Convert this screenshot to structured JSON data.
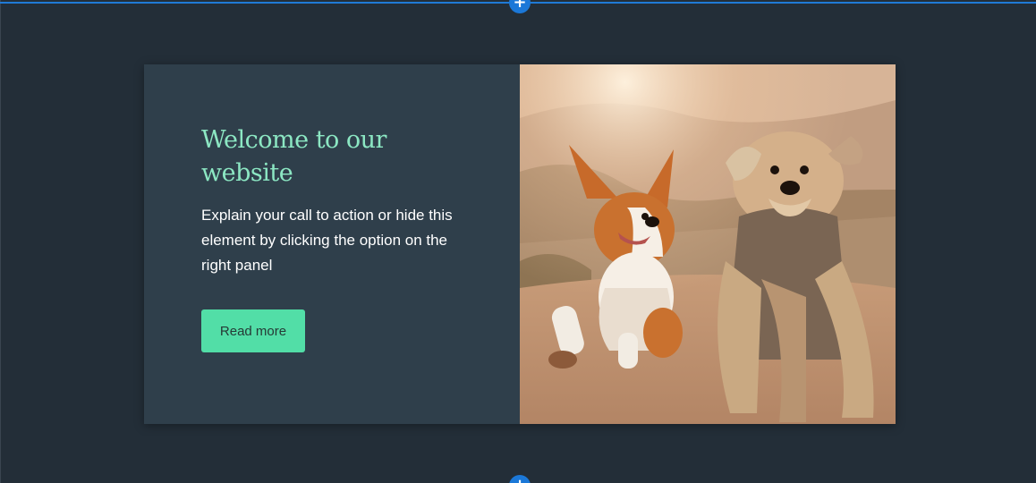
{
  "hero": {
    "heading": "Welcome to our website",
    "description": "Explain your call to action or hide this element by clicking the option on the right panel",
    "button_label": "Read more"
  },
  "editor": {
    "add_section_icon": "plus-icon"
  },
  "image": {
    "subject": "two-dogs-running-photo"
  },
  "colors": {
    "background": "#232e38",
    "panel": "#2f3f4b",
    "heading": "#8ce7c3",
    "button": "#52dea7",
    "editor_accent": "#1b78d8"
  }
}
